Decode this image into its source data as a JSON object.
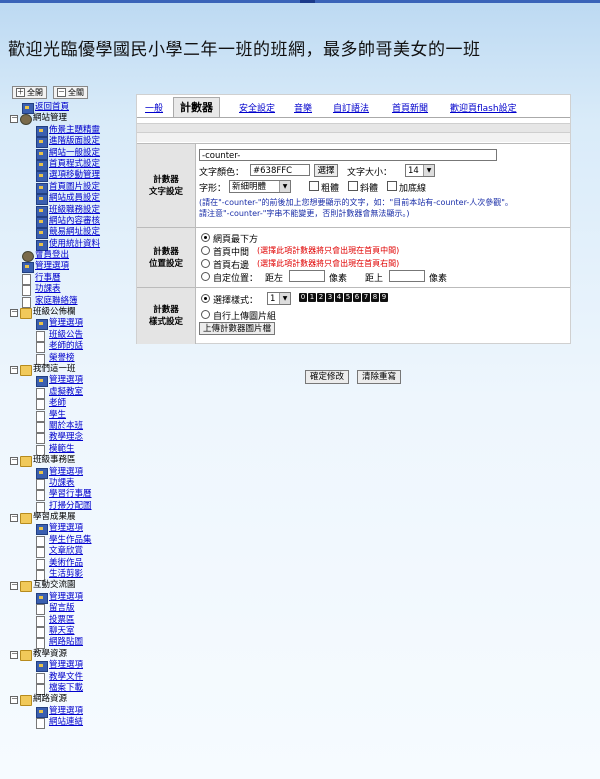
{
  "header": {
    "welcome": "歡迎光臨優學國民小學二年一班的班網，最多帥哥美女的一班"
  },
  "tree_buttons": {
    "collapse": "全開",
    "expand": "全關",
    "collapse_box": "＋",
    "expand_box": "－"
  },
  "tree": [
    {
      "indent": 1,
      "icon": "app",
      "label": "返回首頁",
      "link": true
    },
    {
      "indent": 0,
      "icon": "exp",
      "label": "網站管理",
      "link": false,
      "exp": "－",
      "icon2": "gear"
    },
    {
      "indent": 2,
      "icon": "app",
      "label": "佈景主題精靈",
      "link": true
    },
    {
      "indent": 2,
      "icon": "app",
      "label": "進階版面設定",
      "link": true
    },
    {
      "indent": 2,
      "icon": "app",
      "label": "網站一般設定",
      "link": true
    },
    {
      "indent": 2,
      "icon": "app",
      "label": "首頁程式設定",
      "link": true
    },
    {
      "indent": 2,
      "icon": "app",
      "label": "選項移動管理",
      "link": true
    },
    {
      "indent": 2,
      "icon": "app",
      "label": "首頁圖片設定",
      "link": true
    },
    {
      "indent": 2,
      "icon": "app",
      "label": "網站成員設定",
      "link": true
    },
    {
      "indent": 2,
      "icon": "app",
      "label": "班級職務設定",
      "link": true
    },
    {
      "indent": 2,
      "icon": "app",
      "label": "網站內容審核",
      "link": true
    },
    {
      "indent": 2,
      "icon": "app",
      "label": "競易網址設定",
      "link": true
    },
    {
      "indent": 2,
      "icon": "app",
      "label": "使用統計資料",
      "link": true
    },
    {
      "indent": 1,
      "icon": "gear",
      "label": "會員登出",
      "link": true
    },
    {
      "indent": 1,
      "icon": "app",
      "label": "管理選項",
      "link": true
    },
    {
      "indent": 1,
      "icon": "doc",
      "label": "行事曆",
      "link": true
    },
    {
      "indent": 1,
      "icon": "doc",
      "label": "功課表",
      "link": true
    },
    {
      "indent": 1,
      "icon": "doc",
      "label": "家庭聯絡簿",
      "link": true
    },
    {
      "indent": 0,
      "icon": "folder",
      "label": "班級公佈欄",
      "link": false,
      "exp": "－"
    },
    {
      "indent": 2,
      "icon": "app",
      "label": "管理選項",
      "link": true
    },
    {
      "indent": 2,
      "icon": "doc",
      "label": "班級公告",
      "link": true
    },
    {
      "indent": 2,
      "icon": "doc",
      "label": "老師的話",
      "link": true
    },
    {
      "indent": 2,
      "icon": "doc",
      "label": "榮譽榜",
      "link": true
    },
    {
      "indent": 0,
      "icon": "folder",
      "label": "我們這一班",
      "link": false,
      "exp": "－"
    },
    {
      "indent": 2,
      "icon": "app",
      "label": "管理選項",
      "link": true
    },
    {
      "indent": 2,
      "icon": "doc",
      "label": "虛擬教室",
      "link": true
    },
    {
      "indent": 2,
      "icon": "doc",
      "label": "老師",
      "link": true
    },
    {
      "indent": 2,
      "icon": "doc",
      "label": "學生",
      "link": true
    },
    {
      "indent": 2,
      "icon": "doc",
      "label": "關於本班",
      "link": true
    },
    {
      "indent": 2,
      "icon": "doc",
      "label": "教學理念",
      "link": true
    },
    {
      "indent": 2,
      "icon": "doc",
      "label": "模範生",
      "link": true
    },
    {
      "indent": 0,
      "icon": "folder",
      "label": "班級事務區",
      "link": false,
      "exp": "－"
    },
    {
      "indent": 2,
      "icon": "app",
      "label": "管理選項",
      "link": true
    },
    {
      "indent": 2,
      "icon": "doc",
      "label": "功課表",
      "link": true
    },
    {
      "indent": 2,
      "icon": "doc",
      "label": "學習行事曆",
      "link": true
    },
    {
      "indent": 2,
      "icon": "doc",
      "label": "打掃分配圖",
      "link": true
    },
    {
      "indent": 0,
      "icon": "folder",
      "label": "學習成果展",
      "link": false,
      "exp": "－"
    },
    {
      "indent": 2,
      "icon": "app",
      "label": "管理選項",
      "link": true
    },
    {
      "indent": 2,
      "icon": "doc",
      "label": "學生作品集",
      "link": true
    },
    {
      "indent": 2,
      "icon": "doc",
      "label": "文章欣賞",
      "link": true
    },
    {
      "indent": 2,
      "icon": "doc",
      "label": "美術作品",
      "link": true
    },
    {
      "indent": 2,
      "icon": "doc",
      "label": "生活剪影",
      "link": true
    },
    {
      "indent": 0,
      "icon": "folder",
      "label": "互動交流園",
      "link": false,
      "exp": "－"
    },
    {
      "indent": 2,
      "icon": "app",
      "label": "管理選項",
      "link": true
    },
    {
      "indent": 2,
      "icon": "doc",
      "label": "留言版",
      "link": true
    },
    {
      "indent": 2,
      "icon": "doc",
      "label": "投票區",
      "link": true
    },
    {
      "indent": 2,
      "icon": "doc",
      "label": "聊天室",
      "link": true
    },
    {
      "indent": 2,
      "icon": "doc",
      "label": "網路貼圖",
      "link": true
    },
    {
      "indent": 0,
      "icon": "folder",
      "label": "教學資源",
      "link": false,
      "exp": "－"
    },
    {
      "indent": 2,
      "icon": "app",
      "label": "管理選項",
      "link": true
    },
    {
      "indent": 2,
      "icon": "doc",
      "label": "教學文件",
      "link": true
    },
    {
      "indent": 2,
      "icon": "doc",
      "label": "檔案下載",
      "link": true
    },
    {
      "indent": 0,
      "icon": "folder",
      "label": "網路資源",
      "link": false,
      "exp": "－"
    },
    {
      "indent": 2,
      "icon": "app",
      "label": "管理選項",
      "link": true
    },
    {
      "indent": 2,
      "icon": "doc",
      "label": "網站連結",
      "link": true
    }
  ],
  "tabs": [
    {
      "label": "一般",
      "active": false
    },
    {
      "label": "計數器",
      "active": true
    },
    {
      "label": "安全設定",
      "active": false
    },
    {
      "label": "音樂",
      "active": false
    },
    {
      "label": "自訂語法",
      "active": false
    },
    {
      "label": "首頁新聞",
      "active": false
    },
    {
      "label": "歡迎頁flash設定",
      "active": false
    }
  ],
  "text_settings": {
    "label_line1": "計數器",
    "label_line2": "文字設定",
    "counter_value": "-counter-",
    "color_label": "文字顏色：",
    "color_value": "#638FFC",
    "color_button": "選擇",
    "size_label": "文字大小：",
    "size_value": "14",
    "font_label": "字形：",
    "font_value": "新細明體",
    "bold": "粗體",
    "italic": "斜體",
    "underline": "加底線",
    "hint_line1": "(請在\"-counter-\"的前後加上您想要顯示的文字，如：\"目前本站有-counter-人次參觀\"。",
    "hint_line2": "請注意\"-counter-\"字串不能變更，否則計數器會無法顯示。)"
  },
  "position_settings": {
    "label_line1": "計數器",
    "label_line2": "位置設定",
    "opt_bottom": "網頁最下方",
    "opt_center": "首頁中間",
    "opt_center_note": "(選擇此項計數器將只會出現在首頁中間)",
    "opt_right": "首頁右邊",
    "opt_right_note": "(選擇此項計數器將只會出現在首頁右間)",
    "opt_custom": "自定位置：",
    "left_label": "距左",
    "px1": "像素",
    "top_label": "距上",
    "px2": "像素",
    "selected": "bottom"
  },
  "style_settings": {
    "label_line1": "計數器",
    "label_line2": "樣式設定",
    "opt_style": "選擇樣式：",
    "style_value": "1",
    "digits": [
      "0",
      "1",
      "2",
      "3",
      "4",
      "5",
      "6",
      "7",
      "8",
      "9"
    ],
    "opt_upload": "自行上傳圖片組",
    "upload_button": "上傳計數器圖片檔",
    "selected": "style"
  },
  "actions": {
    "confirm": "確定修改",
    "reset": "清除重寫"
  },
  "colors": {
    "link": "#0000cc",
    "note_red": "#e00000",
    "note_blue": "#1a2ea8",
    "topbar": "#3a63b8"
  }
}
